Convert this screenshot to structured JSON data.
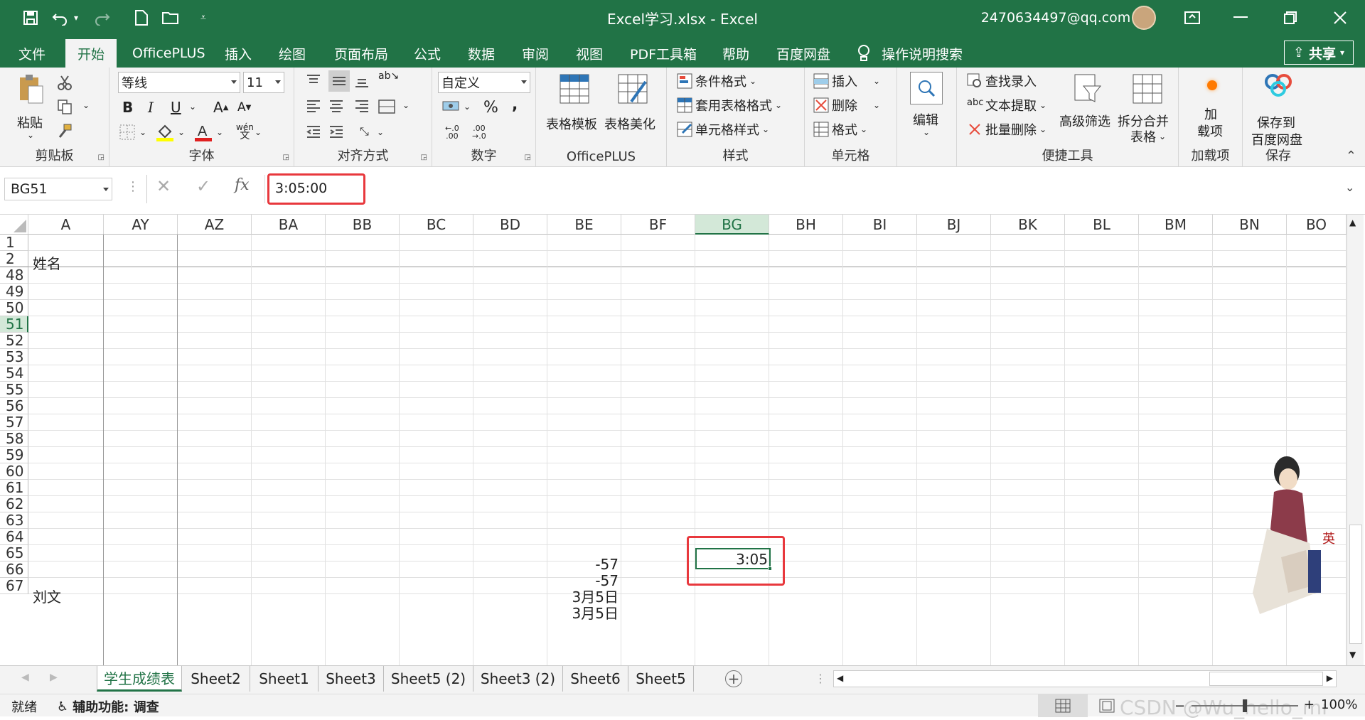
{
  "titlebar": {
    "file": "Excel学习.xlsx  -  Excel",
    "account": "2470634497@qq.com"
  },
  "menu": [
    "文件",
    "开始",
    "OfficePLUS",
    "插入",
    "绘图",
    "页面布局",
    "公式",
    "数据",
    "审阅",
    "视图",
    "PDF工具箱",
    "帮助",
    "百度网盘"
  ],
  "tell_me": "操作说明搜索",
  "share": "共享",
  "ribbon": {
    "clipboard": {
      "paste": "粘贴",
      "group": "剪贴板"
    },
    "font": {
      "name": "等线",
      "size": "11",
      "group": "字体",
      "bold": "B",
      "italic": "I",
      "underline": "U",
      "wen": "wén"
    },
    "align": {
      "group": "对齐方式"
    },
    "number": {
      "format": "自定义",
      "percent": "%",
      "comma": ",",
      "group": "数字"
    },
    "officeplus": {
      "template": "表格模板",
      "beautify": "表格美化",
      "group": "OfficePLUS"
    },
    "styles": {
      "cond": "条件格式",
      "table": "套用表格格式",
      "cell": "单元格样式",
      "group": "样式"
    },
    "cells": {
      "insert": "插入",
      "delete": "删除",
      "format": "格式",
      "group": "单元格"
    },
    "edit": {
      "label": "编辑"
    },
    "tools": {
      "find": "查找录入",
      "extract": "文本提取",
      "batchdel": "批量删除",
      "filter": "高级筛选",
      "split1": "拆分合并",
      "split2": "表格",
      "group": "便捷工具"
    },
    "addin": {
      "l1": "加",
      "l2": "载项",
      "group": "加载项"
    },
    "save": {
      "l1": "保存到",
      "l2": "百度网盘",
      "group": "保存"
    }
  },
  "formula": {
    "namebox": "BG51",
    "fx": "fx",
    "value": "3:05:00"
  },
  "columns": [
    "A",
    "AY",
    "AZ",
    "BA",
    "BB",
    "BC",
    "BD",
    "BE",
    "BF",
    "BG",
    "BH",
    "BI",
    "BJ",
    "BK",
    "BL",
    "BM",
    "BN",
    "BO"
  ],
  "rows": [
    "1",
    "2",
    "48",
    "49",
    "50",
    "51",
    "52",
    "53",
    "54",
    "55",
    "56",
    "57",
    "58",
    "59",
    "60",
    "61",
    "62",
    "63",
    "64",
    "65",
    "66",
    "67"
  ],
  "cells": {
    "a2": "姓名",
    "a53": "刘文",
    "be51": "-57",
    "be52": "-57",
    "be53": "3月5日",
    "be54": "3月5日",
    "bg51": "3:05"
  },
  "tabs": [
    "学生成绩表",
    "Sheet2",
    "Sheet1",
    "Sheet3",
    "Sheet5 (2)",
    "Sheet3 (2)",
    "Sheet6",
    "Sheet5"
  ],
  "status": {
    "ready": "就绪",
    "access": "辅助功能: 调查",
    "zoom": "100%",
    "watermark": "CSDN @Wu_hello_mi"
  },
  "colors": {
    "excel_green": "#217346",
    "highlight": "#e8383d"
  }
}
